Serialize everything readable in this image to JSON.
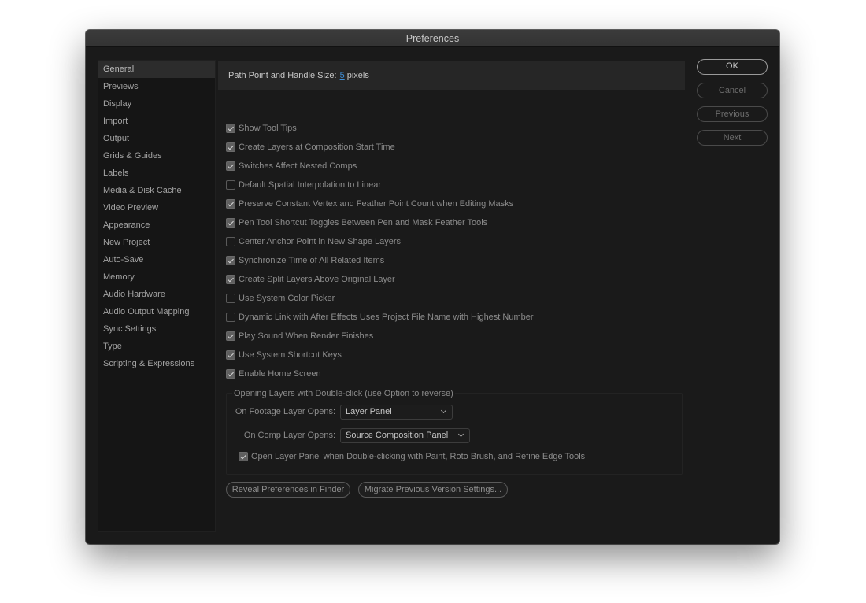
{
  "window": {
    "title": "Preferences"
  },
  "sidebar": {
    "items": [
      {
        "label": "General",
        "active": true
      },
      {
        "label": "Previews"
      },
      {
        "label": "Display"
      },
      {
        "label": "Import"
      },
      {
        "label": "Output"
      },
      {
        "label": "Grids & Guides"
      },
      {
        "label": "Labels"
      },
      {
        "label": "Media & Disk Cache"
      },
      {
        "label": "Video Preview"
      },
      {
        "label": "Appearance"
      },
      {
        "label": "New Project"
      },
      {
        "label": "Auto-Save"
      },
      {
        "label": "Memory"
      },
      {
        "label": "Audio Hardware"
      },
      {
        "label": "Audio Output Mapping"
      },
      {
        "label": "Sync Settings"
      },
      {
        "label": "Type"
      },
      {
        "label": "Scripting & Expressions"
      }
    ]
  },
  "general": {
    "path_label": "Path Point and Handle Size:",
    "path_value": "5",
    "path_unit": "pixels",
    "options": [
      {
        "label": "Show Tool Tips",
        "checked": true
      },
      {
        "label": "Create Layers at Composition Start Time",
        "checked": true
      },
      {
        "label": "Switches Affect Nested Comps",
        "checked": true
      },
      {
        "label": "Default Spatial Interpolation to Linear",
        "checked": false
      },
      {
        "label": "Preserve Constant Vertex and Feather Point Count when Editing Masks",
        "checked": true
      },
      {
        "label": "Pen Tool Shortcut Toggles Between Pen and Mask Feather Tools",
        "checked": true
      },
      {
        "label": "Center Anchor Point in New Shape Layers",
        "checked": false
      },
      {
        "label": "Synchronize Time of All Related Items",
        "checked": true
      },
      {
        "label": "Create Split Layers Above Original Layer",
        "checked": true
      },
      {
        "label": "Use System Color Picker",
        "checked": false
      },
      {
        "label": "Dynamic Link with After Effects Uses Project File Name with Highest Number",
        "checked": false
      },
      {
        "label": "Play Sound When Render Finishes",
        "checked": true
      },
      {
        "label": "Use System Shortcut Keys",
        "checked": true
      },
      {
        "label": "Enable Home Screen",
        "checked": true
      }
    ],
    "group": {
      "title": "Opening Layers with Double-click (use Option to reverse)",
      "footage_label": "On Footage Layer Opens:",
      "footage_value": "Layer Panel",
      "comp_label": "On Comp Layer Opens:",
      "comp_value": "Source Composition Panel",
      "open_layer_panel_label": "Open Layer Panel when Double-clicking with Paint, Roto Brush, and Refine Edge Tools",
      "open_layer_panel_checked": true
    },
    "reveal_label": "Reveal Preferences in Finder",
    "migrate_label": "Migrate Previous Version Settings..."
  },
  "buttons": {
    "ok": "OK",
    "cancel": "Cancel",
    "previous": "Previous",
    "next": "Next"
  }
}
